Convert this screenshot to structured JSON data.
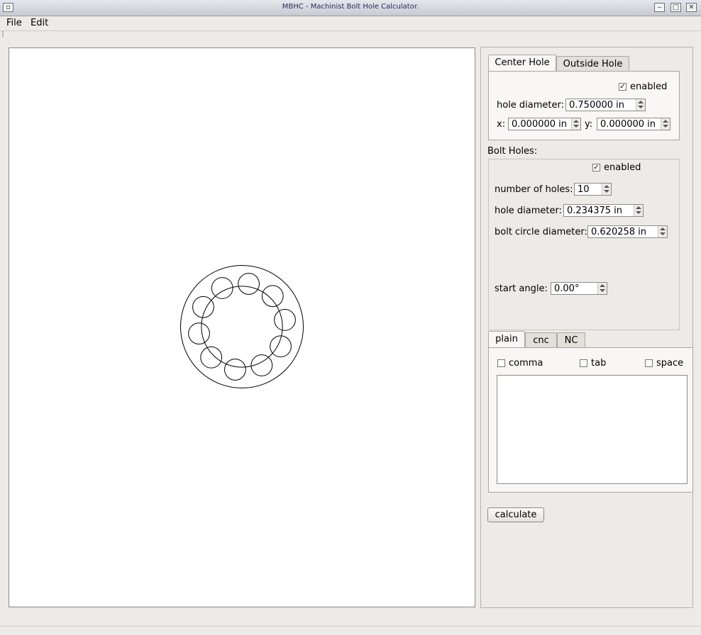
{
  "window": {
    "title": "MBHC - Machinist Bolt Hole Calculator."
  },
  "menu": {
    "file": "File",
    "edit": "Edit"
  },
  "tabs_top": {
    "center": "Center Hole",
    "outside": "Outside Hole"
  },
  "center_hole": {
    "enabled_label": "enabled",
    "enabled": true,
    "diameter_label": "hole diameter:",
    "diameter": "0.750000 in",
    "x_label": "x:",
    "x": "0.000000 in",
    "y_label": "y:",
    "y": "0.000000 in"
  },
  "bolt_holes": {
    "title": "Bolt Holes:",
    "enabled_label": "enabled",
    "enabled": true,
    "count_label": "number of holes:",
    "count": "10",
    "diameter_label": "hole diameter:",
    "diameter": "0.234375 in",
    "circle_label": "bolt circle diameter:",
    "circle_diameter": "0.620258 in",
    "angle_label": "start angle:",
    "angle": "0.00°"
  },
  "output_tabs": {
    "plain": "plain",
    "cnc": "cnc",
    "nc": "NC"
  },
  "separators": {
    "comma": "comma",
    "tab": "tab",
    "space": "space"
  },
  "output_text": "",
  "calculate_label": "calculate"
}
